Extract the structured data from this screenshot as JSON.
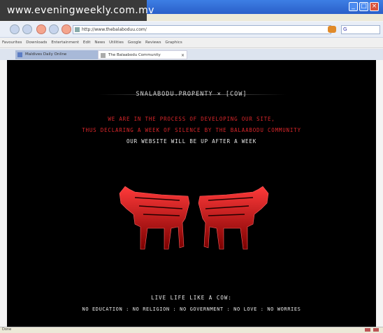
{
  "watermark": "www.eveningweekly.com.mv",
  "browser": {
    "address": "http://www.thebalaboduu.com/",
    "search_placeholder": "G",
    "favorites": [
      "Favourites",
      "Downloads",
      "Entertainment",
      "Edit",
      "News",
      "Utilities",
      "Google",
      "Reviews",
      "Graphics"
    ],
    "tabs": [
      {
        "label": "Maldives Daily Online"
      },
      {
        "label": "The Balaabodu Community"
      }
    ],
    "status": "Done"
  },
  "page": {
    "title": "SNALABODU.PROPENTY × [COW]",
    "red_line1": "WE ARE IN THE PROCESS OF DEVELOPING OUR SITE,",
    "red_line2": "THUS DECLARING A WEEK OF SILENCE BY THE BALAABODU COMMUNITY",
    "white_line": "OUR WEBSITE WILL BE UP AFTER A WEEK",
    "motto": "LIVE LIFE LIKE A COW:",
    "manifesto": "NO EDUCATION : NO RELIGION : NO GOVERNMENT : NO LOVE : NO WORRIES"
  },
  "colors": {
    "accent_red": "#d9262a",
    "background": "#000000"
  }
}
